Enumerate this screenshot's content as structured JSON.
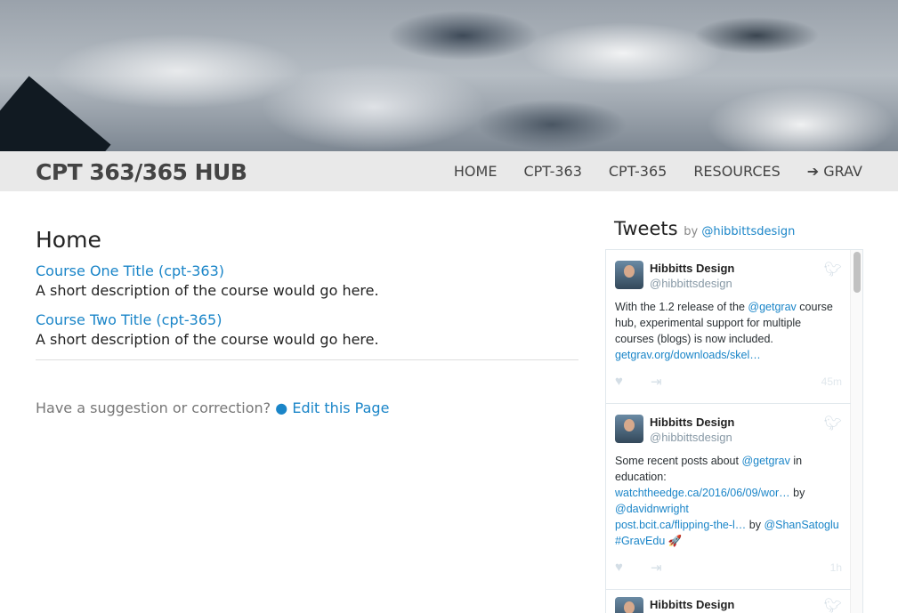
{
  "nav": {
    "logo": "CPT 363/365 HUB",
    "items": [
      "HOME",
      "CPT-363",
      "CPT-365",
      "RESOURCES",
      "GRAV"
    ],
    "grav_icon": "arrow-circle-right-icon"
  },
  "main": {
    "title": "Home",
    "courses": [
      {
        "title": "Course One Title (cpt-363)",
        "desc": "A short description of the course would go here."
      },
      {
        "title": "Course Two Title (cpt-365)",
        "desc": "A short description of the course would go here."
      }
    ],
    "suggest": "Have a suggestion or correction?",
    "edit": "Edit this Page"
  },
  "tweets": {
    "title": "Tweets",
    "by": "by",
    "handle": "@hibbittsdesign",
    "items": [
      {
        "name": "Hibbitts Design",
        "handle": "@hibbittsdesign",
        "time": "45m"
      },
      {
        "name": "Hibbitts Design",
        "handle": "@hibbittsdesign",
        "time": "1h"
      },
      {
        "name": "Hibbitts Design"
      }
    ],
    "t1": {
      "a": "With the 1.2 release of the ",
      "m": "@getgrav",
      "b": " course hub, experimental support for multiple courses (blogs) is now included. ",
      "l": "getgrav.org/downloads/skel…"
    },
    "t2": {
      "a": "Some recent posts about ",
      "m": "@getgrav",
      "b": " in education:",
      "l1": "watchtheedge.ca/2016/06/09/wor…",
      "by1": " by ",
      "m1": "@davidnwright",
      "l2": "post.bcit.ca/flipping-the-l…",
      "by2": " by ",
      "m2": "@ShanSatoglu",
      "tag": "#GravEdu",
      "emoji": "🚀"
    }
  },
  "colors": {
    "link": "#1a85c8",
    "nav_bg": "#e9e9e9"
  }
}
